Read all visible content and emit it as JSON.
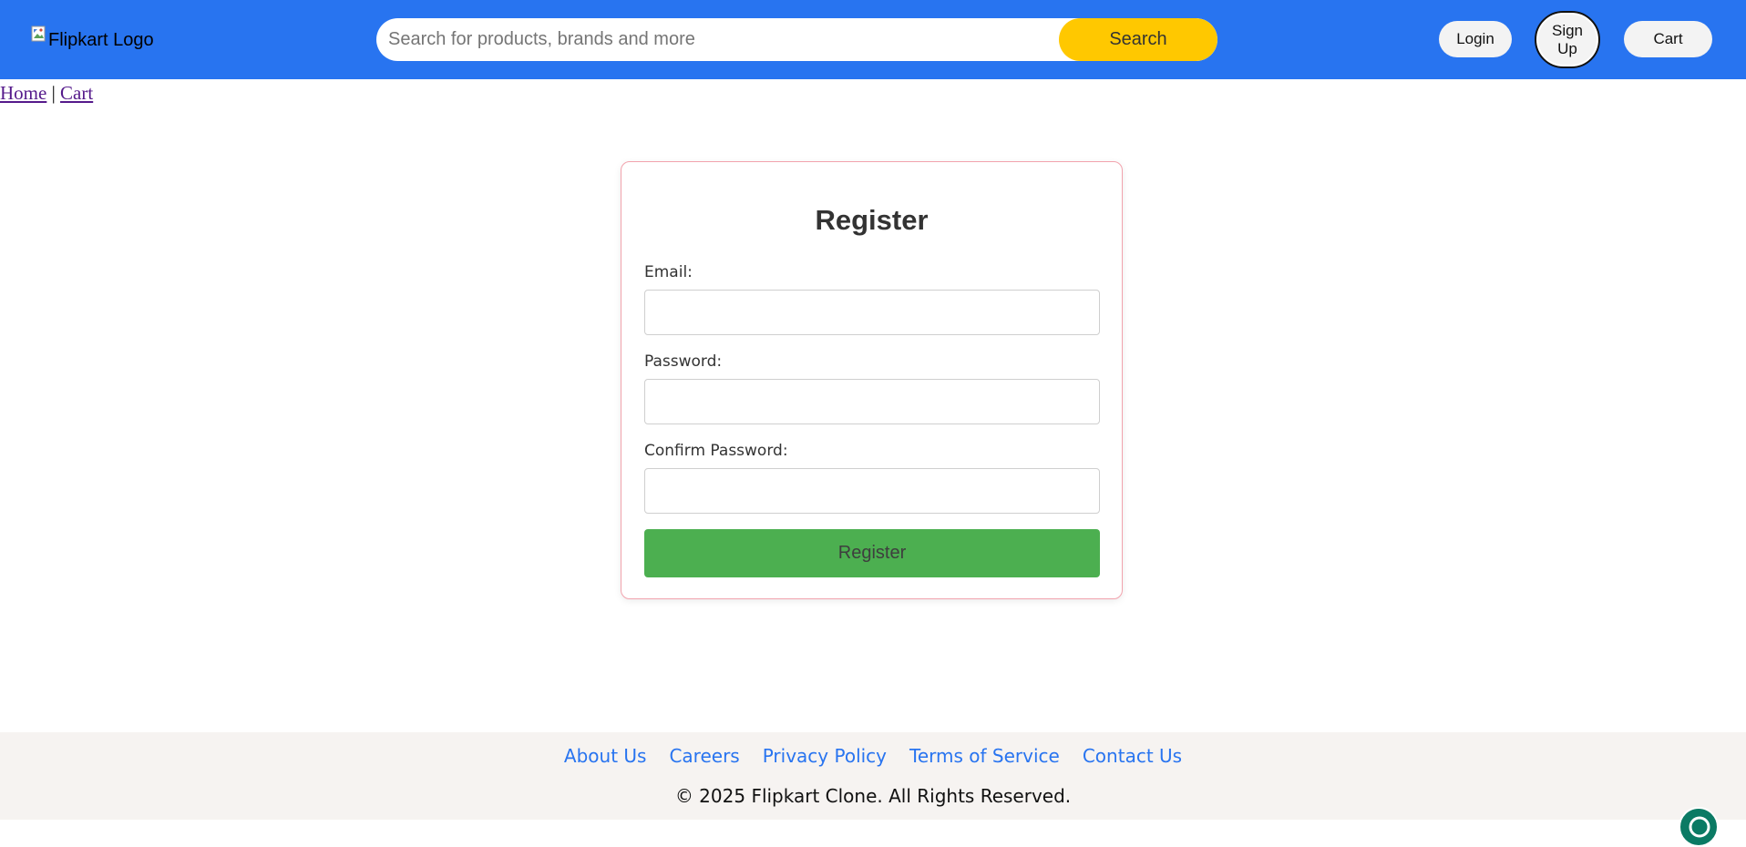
{
  "header": {
    "logo_alt": "Flipkart Logo",
    "search": {
      "placeholder": "Search for products, brands and more",
      "value": "",
      "button_label": "Search"
    },
    "login_label": "Login",
    "signup_label_line1": "Sign",
    "signup_label_line2": "Up",
    "cart_label": "Cart"
  },
  "breadcrumb": {
    "home": "Home",
    "separator": "|",
    "cart": "Cart"
  },
  "register_form": {
    "title": "Register",
    "email_label": "Email:",
    "email_value": "",
    "password_label": "Password:",
    "password_value": "",
    "confirm_label": "Confirm Password:",
    "confirm_value": "",
    "submit_label": "Register"
  },
  "footer": {
    "links": [
      "About Us",
      "Careers",
      "Privacy Policy",
      "Terms of Service",
      "Contact Us"
    ],
    "copyright": "© 2025 Flipkart Clone. All Rights Reserved."
  },
  "icons": {
    "logo": "broken-image-icon",
    "chat": "chat-widget-icon"
  },
  "colors": {
    "header_bg": "#2874f0",
    "search_button": "#ffc800",
    "submit_button": "#4caf50",
    "footer_link": "#2874f0"
  }
}
